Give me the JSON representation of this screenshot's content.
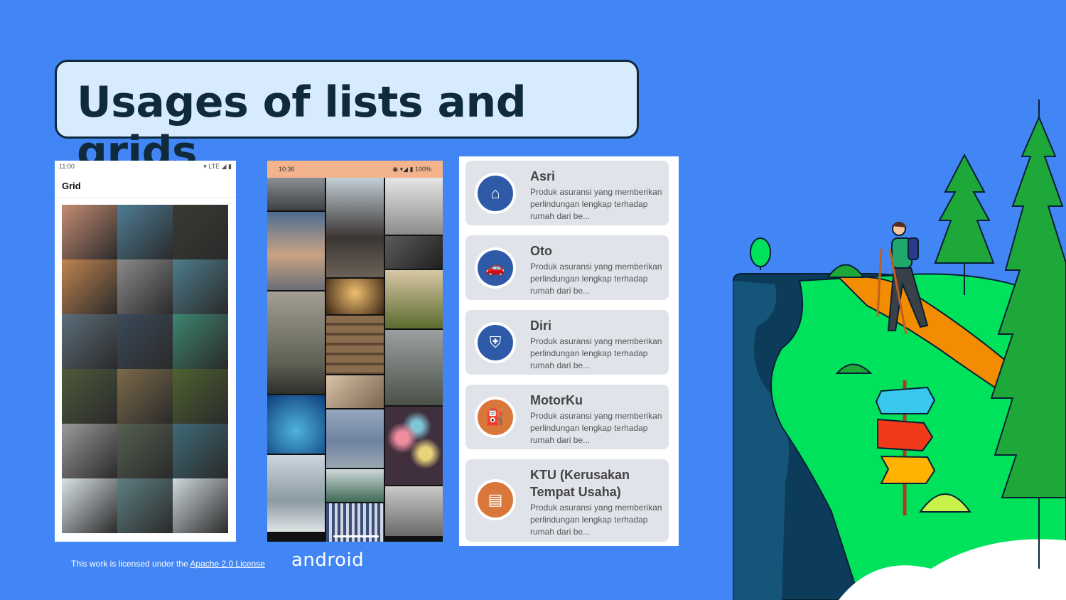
{
  "title": "Usages of lists and grids",
  "phone_grid": {
    "time": "11:00",
    "status_icons": "▾ LTE ◢ ▮",
    "appbar_title": "Grid",
    "tile_colors": [
      "#c48d74",
      "#4e7d96",
      "#3a3a33",
      "#c08450",
      "#8a8a8a",
      "#4d7c8c",
      "#5c6e7a",
      "#3c4a5a",
      "#3d8570",
      "#4f5a3c",
      "#7b6a4a",
      "#4e6230",
      "#9a9a9a",
      "#556050",
      "#3e6a78",
      "#d9e2e6",
      "#5d7f82",
      "#cfd8dc"
    ]
  },
  "phone_staggered": {
    "time": "10:36",
    "status_icons": "◉ ▾◢ ▮ 100%"
  },
  "insurance_list": [
    {
      "name": "Asri",
      "desc": "Produk asuransi yang memberikan perlindungan lengkap terhadap rumah dari be...",
      "color": "#2e5aa8",
      "icon": "home-icon"
    },
    {
      "name": "Oto",
      "desc": "Produk asuransi yang memberikan perlindungan lengkap terhadap rumah dari be...",
      "color": "#2e5aa8",
      "icon": "car-icon"
    },
    {
      "name": "Diri",
      "desc": "Produk asuransi yang memberikan perlindungan lengkap terhadap rumah dari be...",
      "color": "#2e5aa8",
      "icon": "person-shield-icon"
    },
    {
      "name": "MotorKu",
      "desc": "Produk asuransi yang memberikan perlindungan lengkap terhadap rumah dari be...",
      "color": "#d9763a",
      "icon": "motorcycle-icon"
    },
    {
      "name": "KTU (Kerusakan Tempat Usaha)",
      "desc": "Produk asuransi yang memberikan perlindungan lengkap terhadap rumah dari be...",
      "color": "#d9763a",
      "icon": "store-icon"
    }
  ],
  "footer": {
    "prefix": "This work is licensed under the ",
    "link": "Apache 2.0 License"
  },
  "brand": "android"
}
